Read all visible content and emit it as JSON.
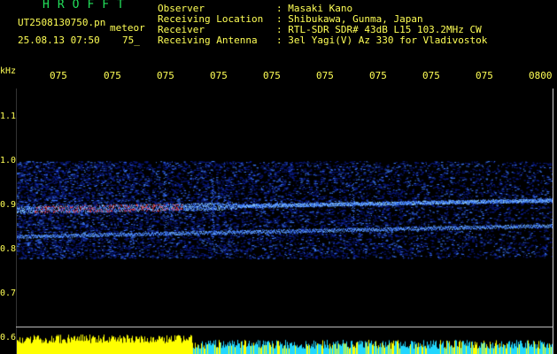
{
  "header": {
    "app_title": "HROFFT",
    "file_name": "UT2508130750.pn",
    "type_label": "meteor",
    "timestamp": "25.08.13 07:50",
    "minute_mark": "75_",
    "info": [
      {
        "label": "Observer",
        "value": ": Masaki Kano"
      },
      {
        "label": "Receiving Location",
        "value": ": Shibukawa, Gunma, Japan"
      },
      {
        "label": "Receiver",
        "value": ": RTL-SDR SDR# 43dB L15 103.2MHz CW"
      },
      {
        "label": "Receiving Antenna",
        "value": ": 3el Yagi(V) Az 330 for Vladivostok"
      }
    ]
  },
  "spectrogram": {
    "axis_unit": "kHz",
    "time_ticks": [
      "075",
      "075",
      "075",
      "075",
      "075",
      "075",
      "075",
      "075",
      "075",
      "0800"
    ],
    "freq_ticks": [
      "1.1",
      "1.0",
      "0.9",
      "0.8",
      "0.7",
      "0.6"
    ],
    "colors": {
      "background": "#000000",
      "noise": "#0a1a8a",
      "signal": "#3d7bff",
      "hot": "#ff3a3a",
      "label": "#ffff55",
      "title": "#22e05a",
      "meter_high": "#ffff00",
      "meter_low": "#21d7ff"
    }
  }
}
